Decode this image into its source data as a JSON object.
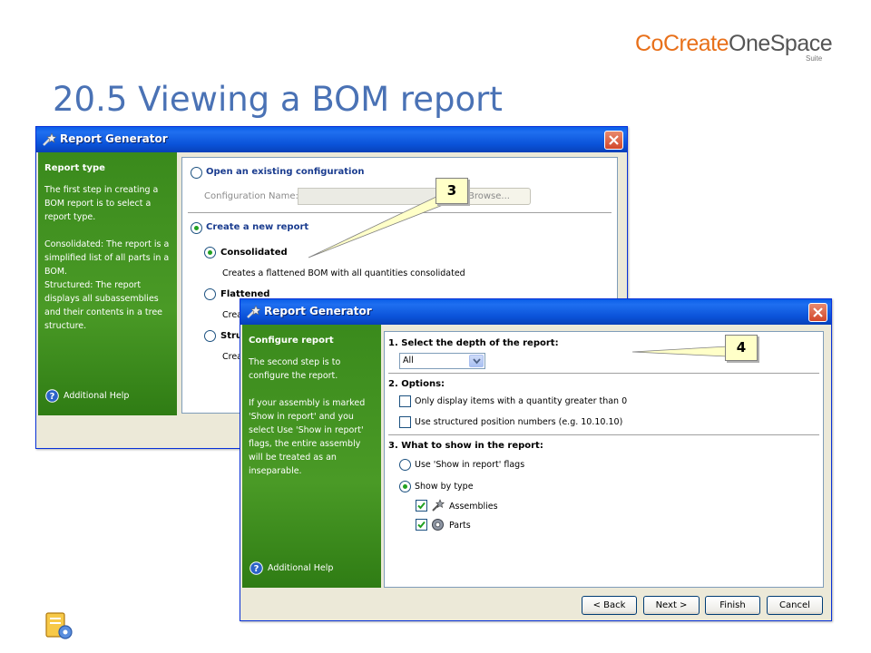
{
  "brand": {
    "logo_part1": "CoCreate",
    "logo_part2": "OneSpace",
    "logo_suite": "Suite"
  },
  "slide_title": "20.5 Viewing a BOM report",
  "window1": {
    "title": "Report Generator",
    "sidebar": {
      "heading": "Report type",
      "paragraphs": [
        "The first step in creating a BOM report is to select a report type.",
        "Consolidated: The report is a simplified list of all parts in a BOM.",
        "Structured: The report displays all subassemblies and their contents in a tree structure."
      ],
      "help": "Additional Help"
    },
    "open_existing_label": "Open an existing configuration",
    "config_name_label": "Configuration Name:",
    "browse_label": "Browse...",
    "create_new_label": "Create a new report",
    "consolidated_label": "Consolidated",
    "consolidated_desc": "Creates a flattened BOM with all quantities consolidated",
    "flattened_label": "Flattened",
    "flattened_desc_visible": "Crea",
    "structured_label_visible": "Stru",
    "structured_desc_visible": "Crea"
  },
  "window2": {
    "title": "Report Generator",
    "sidebar": {
      "heading": "Configure report",
      "paragraphs": [
        "The second step is to configure the report.",
        "If your assembly is marked 'Show in report' and you select Use 'Show in report' flags, the entire assembly will be treated as an inseparable."
      ],
      "help": "Additional Help"
    },
    "section1": {
      "label": "1.  Select the depth of the report:",
      "depth_value": "All"
    },
    "section2": {
      "label": "2. Options:",
      "opt1": "Only display items with a quantity greater than 0",
      "opt1_checked": false,
      "opt2": "Use structured position numbers (e.g. 10.10.10)",
      "opt2_checked": false
    },
    "section3": {
      "label": "3. What to show in the report:",
      "radio1": "Use 'Show in report' flags",
      "radio2": "Show by type",
      "assemblies": "Assemblies",
      "assemblies_checked": true,
      "parts": "Parts",
      "parts_checked": true
    },
    "buttons": {
      "back": "< Back",
      "next": "Next >",
      "finish": "Finish",
      "cancel": "Cancel"
    }
  },
  "callouts": {
    "c3": "3",
    "c4": "4"
  },
  "colors": {
    "title_blue": "#4a72b5",
    "xp_titlebar": "#0a52d8",
    "sidebar_green": "#3a8a1c",
    "logo_orange": "#e8701a",
    "callout_yellow": "#ffffc8"
  }
}
